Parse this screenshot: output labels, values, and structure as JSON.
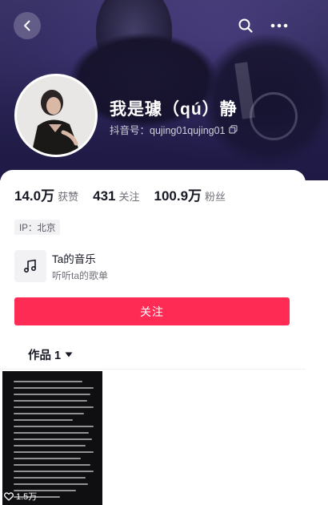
{
  "profile": {
    "display_name": "我是璩（qú）静",
    "account_id": "抖音号：qujing01qujing01"
  },
  "stats": [
    {
      "value": "14.0万",
      "label": "获赞"
    },
    {
      "value": "431",
      "label": "关注"
    },
    {
      "value": "100.9万",
      "label": "粉丝"
    }
  ],
  "ip_location": "IP：北京",
  "music": {
    "title": "Ta的音乐",
    "subtitle": "听听ta的歌单"
  },
  "follow_button": "关注",
  "works_tab": {
    "label": "作品 1"
  },
  "videos": [
    {
      "likes": "1.5万"
    }
  ],
  "colors": {
    "accent": "#fe2c55",
    "banner": "#2c2757"
  },
  "icons": [
    "back-icon",
    "search-icon",
    "more-icon",
    "copy-icon",
    "music-icon",
    "dropdown-icon",
    "heart-icon"
  ]
}
